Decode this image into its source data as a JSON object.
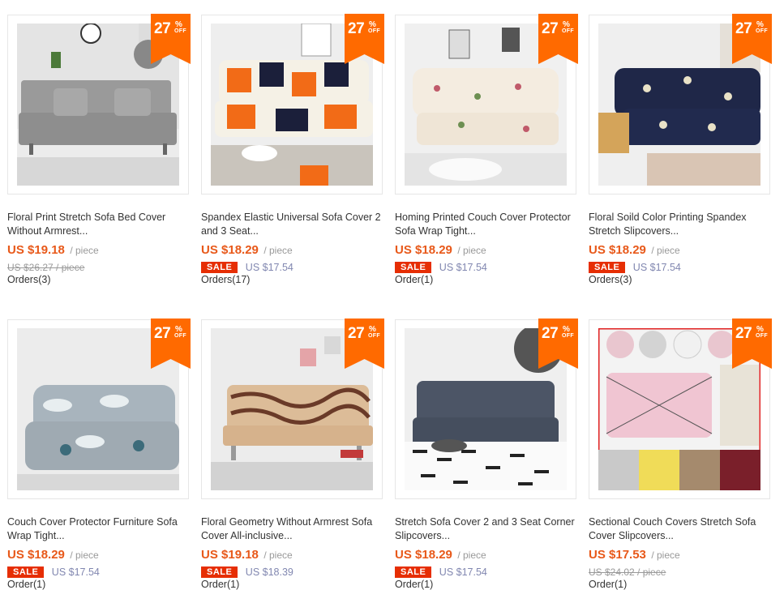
{
  "products": [
    {
      "discount_num": "27",
      "discount_pct": "%",
      "discount_off": "OFF",
      "title_line1": "Floral Print Stretch Sofa Bed Cover",
      "title_line2": "Without Armrest...",
      "price": "US $19.18",
      "unit": "/ piece",
      "old_price": "US $26.27 / piece",
      "sale_label": "",
      "sale_price": "",
      "orders": "Orders(3)",
      "image": "gray-futon-sofa-photo"
    },
    {
      "discount_num": "27",
      "discount_pct": "%",
      "discount_off": "OFF",
      "title_line1": "Spandex Elastic Universal Sofa Cover 2",
      "title_line2": "and 3 Seat...",
      "price": "US $18.29",
      "unit": "/ piece",
      "old_price": "",
      "sale_label": "SALE",
      "sale_price": "US $17.54",
      "orders": "Orders(17)",
      "image": "orange-geometric-sofa-photo"
    },
    {
      "discount_num": "27",
      "discount_pct": "%",
      "discount_off": "OFF",
      "title_line1": "Homing Printed Couch Cover Protector",
      "title_line2": "Sofa Wrap Tight...",
      "price": "US $18.29",
      "unit": "/ piece",
      "old_price": "",
      "sale_label": "SALE",
      "sale_price": "US $17.54",
      "orders": "Order(1)",
      "image": "floral-cream-sofa-photo"
    },
    {
      "discount_num": "27",
      "discount_pct": "%",
      "discount_off": "OFF",
      "title_line1": "Floral Soild Color Printing Spandex",
      "title_line2": "Stretch Slipcovers...",
      "price": "US $18.29",
      "unit": "/ piece",
      "old_price": "",
      "sale_label": "SALE",
      "sale_price": "US $17.54",
      "orders": "Orders(3)",
      "image": "navy-floral-sofa-photo"
    },
    {
      "discount_num": "27",
      "discount_pct": "%",
      "discount_off": "OFF",
      "title_line1": "Couch Cover Protector Furniture Sofa",
      "title_line2": "Wrap Tight...",
      "price": "US $18.29",
      "unit": "/ piece",
      "old_price": "",
      "sale_label": "SALE",
      "sale_price": "US $17.54",
      "orders": "Order(1)",
      "image": "leaf-print-loveseat-photo"
    },
    {
      "discount_num": "27",
      "discount_pct": "%",
      "discount_off": "OFF",
      "title_line1": "Floral Geometry Without Armrest Sofa",
      "title_line2": "Cover All-inclusive...",
      "price": "US $19.18",
      "unit": "/ piece",
      "old_price": "",
      "sale_label": "SALE",
      "sale_price": "US $18.39",
      "orders": "Order(1)",
      "image": "wave-print-futon-photo"
    },
    {
      "discount_num": "27",
      "discount_pct": "%",
      "discount_off": "OFF",
      "title_line1": "Stretch Sofa Cover 2 and 3 Seat Corner",
      "title_line2": "Slipcovers...",
      "price": "US $18.29",
      "unit": "/ piece",
      "old_price": "",
      "sale_label": "SALE",
      "sale_price": "US $17.54",
      "orders": "Order(1)",
      "image": "charcoal-sofa-rug-photo"
    },
    {
      "discount_num": "27",
      "discount_pct": "%",
      "discount_off": "OFF",
      "title_line1": "Sectional Couch Covers Stretch Sofa",
      "title_line2": "Cover Slipcovers...",
      "price": "US $17.53",
      "unit": "/ piece",
      "old_price": "US $24.02 / piece",
      "sale_label": "",
      "sale_price": "",
      "orders": "Order(1)",
      "image": "pink-sofa-collage-photo"
    }
  ],
  "colors": {
    "price": "#e8591a",
    "badge": "#ff6a00",
    "sale": "#e62e04",
    "sale_price": "#8187b0"
  }
}
